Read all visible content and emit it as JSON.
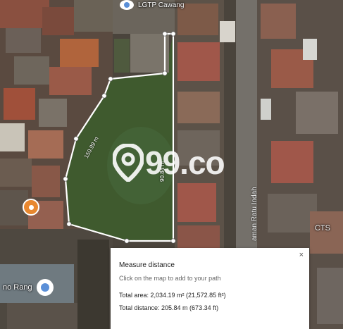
{
  "map": {
    "labels": {
      "top_place": "LGTP Cawang",
      "bottom_place": "no Rang",
      "right_place": "CTS"
    },
    "street_name": "aman Ratu Indah",
    "segment_labels": {
      "left_edge": "150.99 m",
      "right_edge": "90.84 m"
    },
    "colors": {
      "measure_line": "#ffffff",
      "grass": "#3f5a2e",
      "roof_red": "#a0574a",
      "pin_orange": "#e8872f",
      "pin_blue": "#5a8fd8"
    }
  },
  "watermark": {
    "text": "99.co",
    "icon": "location-pin-icon"
  },
  "measure_panel": {
    "title": "Measure distance",
    "hint": "Click on the map to add to your path",
    "total_area": "Total area: 2,034.19 m² (21,572.85 ft²)",
    "total_distance": "Total distance: 205.84 m (673.34 ft)",
    "close_icon": "close-icon",
    "close_label": "×"
  }
}
